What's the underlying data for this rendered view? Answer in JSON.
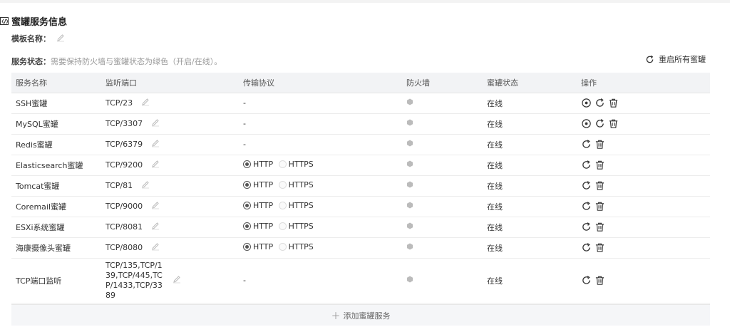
{
  "section": {
    "title": "蜜罐服务信息"
  },
  "template": {
    "label": "模板名称："
  },
  "status": {
    "label": "服务状态：",
    "hint": "需要保持防火墙与蜜罐状态为绿色（开启/在线）。"
  },
  "restart_all": {
    "label": "重启所有蜜罐"
  },
  "table": {
    "headers": [
      "服务名称",
      "监听端口",
      "传输协议",
      "防火墙",
      "蜜罐状态",
      "操作"
    ],
    "rows": [
      {
        "name": "SSH蜜罐",
        "port": "TCP/23",
        "protocol": "-",
        "status": "在线",
        "ops": [
          "target",
          "restart",
          "delete"
        ]
      },
      {
        "name": "MySQL蜜罐",
        "port": "TCP/3307",
        "protocol": "-",
        "status": "在线",
        "ops": [
          "target",
          "restart",
          "delete"
        ]
      },
      {
        "name": "Redis蜜罐",
        "port": "TCP/6379",
        "protocol": "-",
        "status": "在线",
        "ops": [
          "restart",
          "delete"
        ]
      },
      {
        "name": "Elasticsearch蜜罐",
        "port": "TCP/9200",
        "protocol": "radio",
        "status": "在线",
        "ops": [
          "restart",
          "delete"
        ]
      },
      {
        "name": "Tomcat蜜罐",
        "port": "TCP/81",
        "protocol": "radio",
        "status": "在线",
        "ops": [
          "restart",
          "delete"
        ]
      },
      {
        "name": "Coremail蜜罐",
        "port": "TCP/9000",
        "protocol": "radio",
        "status": "在线",
        "ops": [
          "restart",
          "delete"
        ]
      },
      {
        "name": "ESXi系统蜜罐",
        "port": "TCP/8081",
        "protocol": "radio",
        "status": "在线",
        "ops": [
          "restart",
          "delete"
        ]
      },
      {
        "name": "海康摄像头蜜罐",
        "port": "TCP/8080",
        "protocol": "radio",
        "status": "在线",
        "ops": [
          "restart",
          "delete"
        ]
      },
      {
        "name": "TCP端口监听",
        "port": "TCP/135,TCP/139,TCP/445,TCP/1433,TCP/3389",
        "protocol": "-",
        "status": "在线",
        "ops": [
          "restart",
          "delete"
        ]
      }
    ]
  },
  "protocol_options": {
    "http": "HTTP",
    "https": "HTTPS",
    "selected": "HTTP"
  },
  "add_button": {
    "label": "添加蜜罐服务"
  },
  "colors": {
    "online": "#52c41a",
    "header_bg": "#f2f3f5",
    "firewall_dot": "#bbbbbb"
  }
}
